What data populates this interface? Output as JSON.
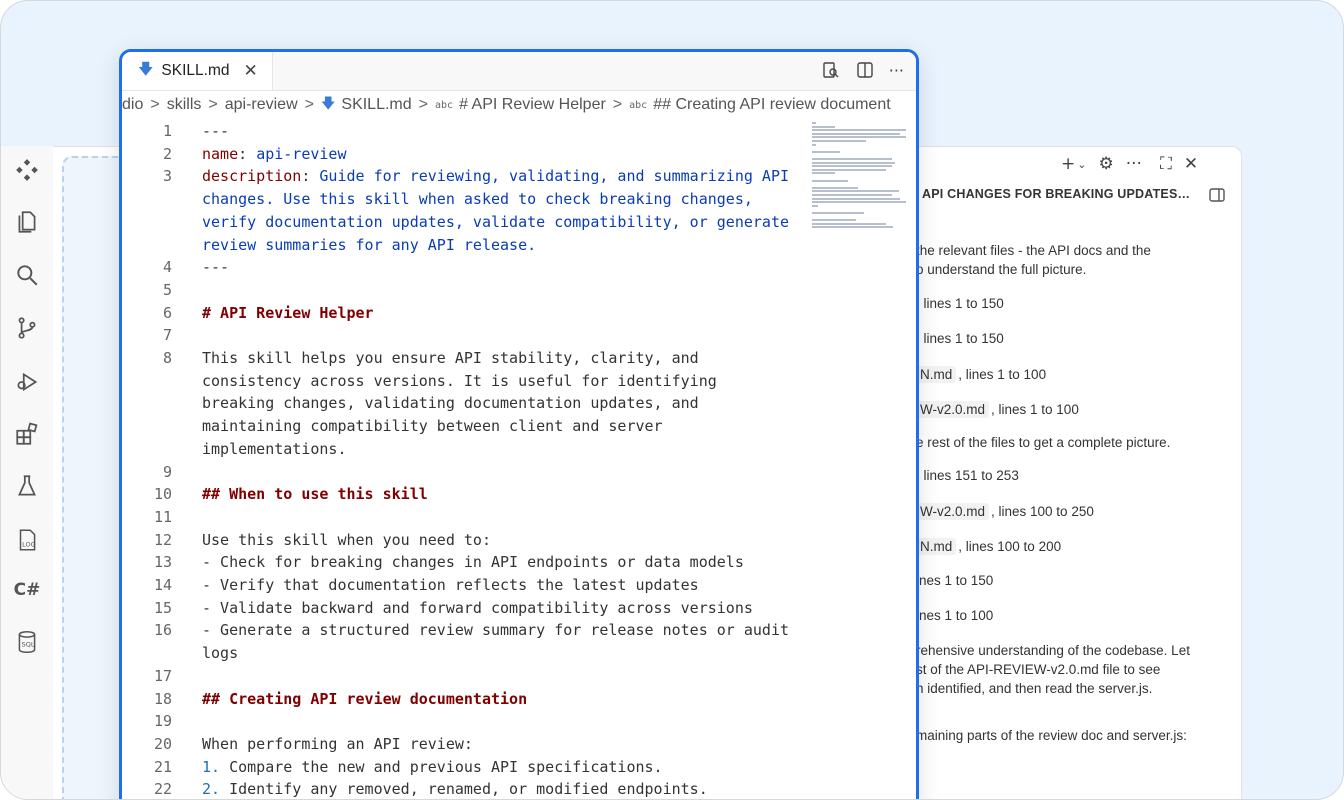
{
  "editor": {
    "tab": {
      "label": "SKILL.md"
    },
    "breadcrumb": [
      "dio",
      "skills",
      "api-review",
      "SKILL.md",
      "# API Review Helper",
      "## Creating API review document"
    ],
    "lines": [
      {
        "n": "1",
        "segs": [
          {
            "t": "---",
            "c": "plain"
          }
        ]
      },
      {
        "n": "2",
        "segs": [
          {
            "t": "name",
            "c": "key"
          },
          {
            "t": ": ",
            "c": "plain"
          },
          {
            "t": "api-review",
            "c": "val"
          }
        ]
      },
      {
        "n": "3",
        "segs": [
          {
            "t": "description",
            "c": "key"
          },
          {
            "t": ": ",
            "c": "plain"
          },
          {
            "t": "Guide for reviewing, validating, and summarizing API",
            "c": "val"
          }
        ]
      },
      {
        "n": "",
        "segs": [
          {
            "t": "changes. Use this skill when asked to check breaking changes,",
            "c": "val"
          }
        ]
      },
      {
        "n": "",
        "segs": [
          {
            "t": "verify documentation updates, validate compatibility, or generate",
            "c": "val"
          }
        ]
      },
      {
        "n": "",
        "segs": [
          {
            "t": "review summaries for any API release.",
            "c": "val"
          }
        ]
      },
      {
        "n": "4",
        "segs": [
          {
            "t": "---",
            "c": "plain"
          }
        ]
      },
      {
        "n": "5",
        "segs": []
      },
      {
        "n": "6",
        "segs": [
          {
            "t": "# API Review Helper",
            "c": "head"
          }
        ]
      },
      {
        "n": "7",
        "segs": []
      },
      {
        "n": "8",
        "segs": [
          {
            "t": "This skill helps you ensure API stability, clarity, and",
            "c": "plain"
          }
        ]
      },
      {
        "n": "",
        "segs": [
          {
            "t": "consistency across versions. It is useful for identifying",
            "c": "plain"
          }
        ]
      },
      {
        "n": "",
        "segs": [
          {
            "t": "breaking changes, validating documentation updates, and",
            "c": "plain"
          }
        ]
      },
      {
        "n": "",
        "segs": [
          {
            "t": "maintaining compatibility between client and server",
            "c": "plain"
          }
        ]
      },
      {
        "n": "",
        "segs": [
          {
            "t": "implementations.",
            "c": "plain"
          }
        ]
      },
      {
        "n": "9",
        "segs": []
      },
      {
        "n": "10",
        "segs": [
          {
            "t": "## When to use this skill",
            "c": "head"
          }
        ]
      },
      {
        "n": "11",
        "segs": []
      },
      {
        "n": "12",
        "segs": [
          {
            "t": "Use this skill when you need to:",
            "c": "plain"
          }
        ]
      },
      {
        "n": "13",
        "segs": [
          {
            "t": "- Check for breaking changes in API endpoints or data models",
            "c": "plain"
          }
        ]
      },
      {
        "n": "14",
        "segs": [
          {
            "t": "- Verify that documentation reflects the latest updates",
            "c": "plain"
          }
        ]
      },
      {
        "n": "15",
        "segs": [
          {
            "t": "- Validate backward and forward compatibility across versions",
            "c": "plain"
          }
        ]
      },
      {
        "n": "16",
        "segs": [
          {
            "t": "- Generate a structured review summary for release notes or audit",
            "c": "plain"
          }
        ]
      },
      {
        "n": "",
        "segs": [
          {
            "t": "logs",
            "c": "plain"
          }
        ]
      },
      {
        "n": "17",
        "segs": []
      },
      {
        "n": "18",
        "segs": [
          {
            "t": "## Creating API review documentation",
            "c": "head"
          }
        ]
      },
      {
        "n": "19",
        "segs": []
      },
      {
        "n": "20",
        "segs": [
          {
            "t": "When performing an API review:",
            "c": "plain"
          }
        ]
      },
      {
        "n": "21",
        "segs": [
          {
            "t": "1.",
            "c": "num"
          },
          {
            "t": " Compare the new and previous API specifications.",
            "c": "plain"
          }
        ]
      },
      {
        "n": "22",
        "segs": [
          {
            "t": "2.",
            "c": "num"
          },
          {
            "t": " Identify any removed, renamed, or modified endpoints.",
            "c": "plain"
          }
        ]
      }
    ]
  },
  "chat": {
    "title": "API CHANGES FOR BREAKING UPDATES A...",
    "lines": [
      {
        "chip": "",
        "text": "the relevant files - the API docs and the"
      },
      {
        "chip": "",
        "text": "o understand the full picture."
      },
      {
        "chip": "",
        "text": ", lines 1 to 150"
      },
      {
        "chip": "",
        "text": ", lines 1 to 150"
      },
      {
        "chip": "N.md",
        "text": ", lines 1 to 100"
      },
      {
        "chip": "W-v2.0.md",
        "text": ", lines 1 to 100"
      },
      {
        "chip": "",
        "text": "e rest of the files to get a complete picture."
      },
      {
        "chip": "",
        "text": ", lines 151 to 253"
      },
      {
        "chip": "W-v2.0.md",
        "text": ", lines 100 to 250"
      },
      {
        "chip": "N.md",
        "text": ", lines 100 to 200"
      },
      {
        "chip": "",
        "text": "ines 1 to 150"
      },
      {
        "chip": "",
        "text": "ines 1 to 100"
      },
      {
        "chip": "",
        "text": "rehensive understanding of the codebase. Let"
      },
      {
        "chip": "",
        "text": "st of the API-REVIEW-v2.0.md file to see"
      },
      {
        "chip": "",
        "text": "n identified, and then read the server.js."
      },
      {
        "chip": "",
        "text": "maining parts of the review doc and server.js:"
      }
    ]
  },
  "activity": {
    "icons": [
      "extensions-icon",
      "explorer-icon",
      "search-icon",
      "source-control-icon",
      "run-debug-icon",
      "extensions-marketplace-icon",
      "testing-icon",
      "log-icon",
      "csharp-icon",
      "sql-icon"
    ],
    "log_label": "LOG",
    "csharp_label": "C#",
    "sql_label": "SQL"
  }
}
